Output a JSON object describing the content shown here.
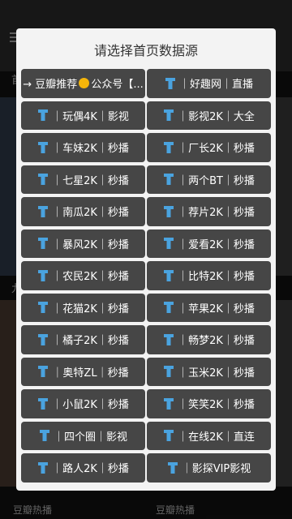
{
  "background": {
    "left_letter_top": "首",
    "left_letter_mid": "九",
    "bottom_label_left": "豆瓣热播",
    "bottom_label_right": "豆瓣热播"
  },
  "dialog": {
    "title": "请选择首页数据源",
    "first_source": {
      "prefix": "→ 豆瓣推荐",
      "suffix": "公众号【...",
      "icon": "coin-icon"
    },
    "sources": [
      "｜好趣网｜直播",
      "｜玩偶4K｜影视",
      "｜影视2K｜大全",
      "｜车妹2K｜秒播",
      "｜厂长2K｜秒播",
      "｜七星2K｜秒播",
      "｜两个BT｜秒播",
      "｜南瓜2K｜秒播",
      "｜荐片2K｜秒播",
      "｜暴风2K｜秒播",
      "｜爱看2K｜秒播",
      "｜农民2K｜秒播",
      "｜比特2K｜秒播",
      "｜花猫2K｜秒播",
      "｜苹果2K｜秒播",
      "｜橘子2K｜秒播",
      "｜畅梦2K｜秒播",
      "｜奥特ZL｜秒播",
      "｜玉米2K｜秒播",
      "｜小鼠2K｜秒播",
      "｜笑笑2K｜秒播",
      "｜四个圈｜影视",
      "｜在线2K｜直连",
      "｜路人2K｜秒播",
      "｜影探VIP影视"
    ],
    "icon_color": "#4aa3df",
    "button_color": "#464646"
  }
}
